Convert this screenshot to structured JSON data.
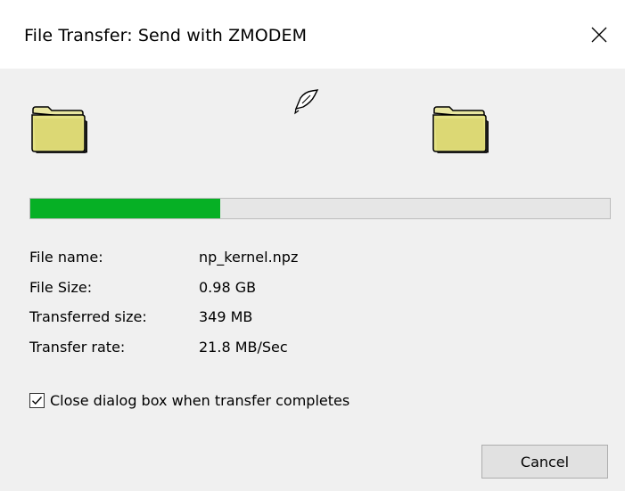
{
  "window": {
    "title": "File Transfer: Send with ZMODEM",
    "close_icon": "close-icon"
  },
  "icons": {
    "source_folder": "folder-icon",
    "destination_folder": "folder-icon",
    "transfer_animation": "flying-paper-icon"
  },
  "progress": {
    "fraction": 0.328,
    "fill_color": "#06b025",
    "track_color": "#e6e6e6"
  },
  "info": {
    "file_name_label": "File name:",
    "file_name_value": "np_kernel.npz",
    "file_size_label": "File Size:",
    "file_size_value": "0.98 GB",
    "transferred_label": "Transferred size:",
    "transferred_value": "349 MB",
    "rate_label": "Transfer rate:",
    "rate_value": "21.8 MB/Sec"
  },
  "options": {
    "close_on_complete_label": "Close dialog box when transfer completes",
    "close_on_complete_checked": true
  },
  "buttons": {
    "cancel_label": "Cancel"
  }
}
